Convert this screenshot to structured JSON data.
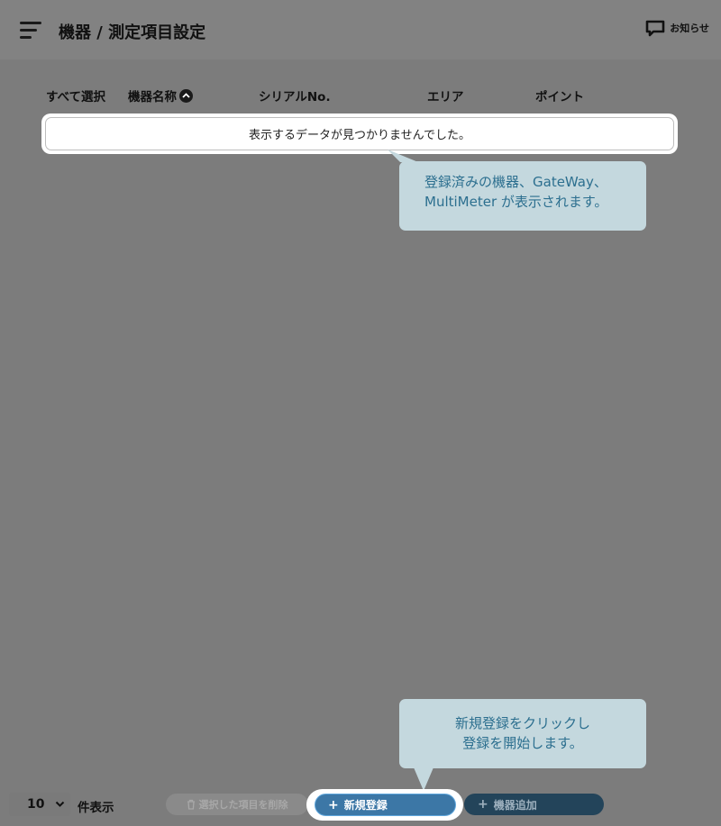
{
  "header": {
    "title": "機器 / 測定項目設定",
    "notice_label": "お知らせ"
  },
  "table": {
    "columns": {
      "select_all": "すべて選択",
      "device_name": "機器名称",
      "serial": "シリアルNo.",
      "area": "エリア",
      "point": "ポイント"
    },
    "empty_message": "表示するデータが見つかりませんでした。"
  },
  "tooltips": {
    "list_line1": "登録済みの機器、GateWay、",
    "list_line2": "MultiMeter が表示されます。",
    "register_line1": "新規登録をクリックし",
    "register_line2": "登録を開始します。"
  },
  "footer": {
    "page_size": "10",
    "page_size_label": "件表示",
    "delete_label": "選択した項目を削除",
    "new_label": "新規登録",
    "add_label": "機器追加"
  },
  "colors": {
    "overlay": "#7c7c7c",
    "tooltip_bg": "#c4d8de",
    "tooltip_text": "#2c6f8f",
    "primary": "#3c77a6",
    "secondary": "#23445a"
  }
}
